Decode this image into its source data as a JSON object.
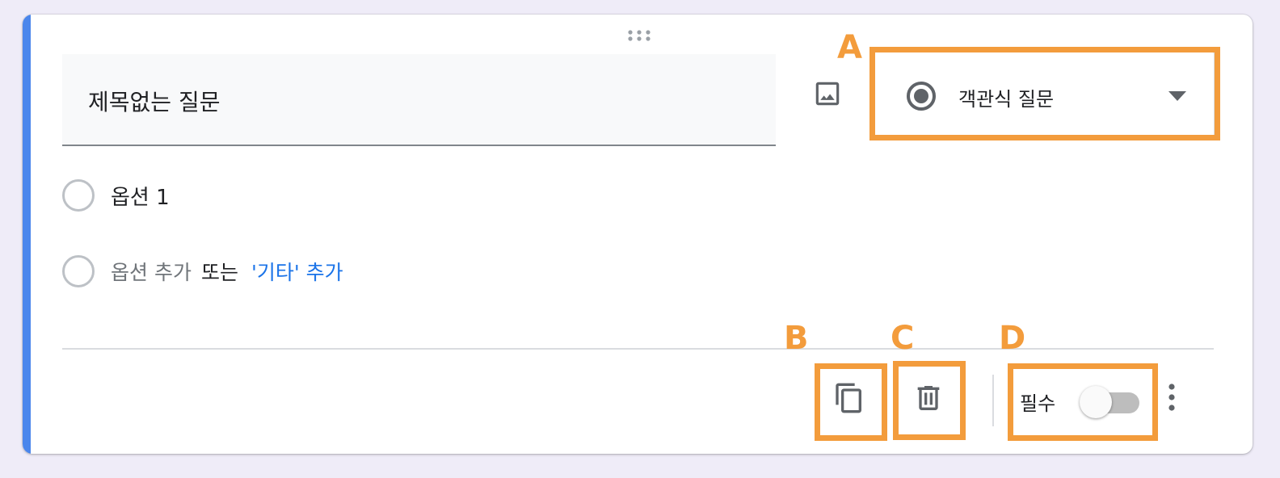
{
  "question": {
    "title": "제목없는 질문",
    "type_label": "객관식 질문",
    "options": [
      "옵션 1"
    ],
    "add_option_label": "옵션 추가",
    "or_label": "또는",
    "add_other_label": "'기타' 추가",
    "required_label": "필수",
    "required_on": false
  },
  "annotations": {
    "a": "A",
    "b": "B",
    "c": "C",
    "d": "D"
  },
  "icons": {
    "drag": "drag-handle-icon",
    "image": "image-icon",
    "type": "radio-button-icon",
    "dropdown": "chevron-down-icon",
    "copy": "copy-icon",
    "delete": "trash-icon",
    "more": "more-vertical-icon"
  },
  "colors": {
    "accent": "#4a86ec",
    "link": "#1a73e8",
    "annotation": "#f39c3c"
  }
}
